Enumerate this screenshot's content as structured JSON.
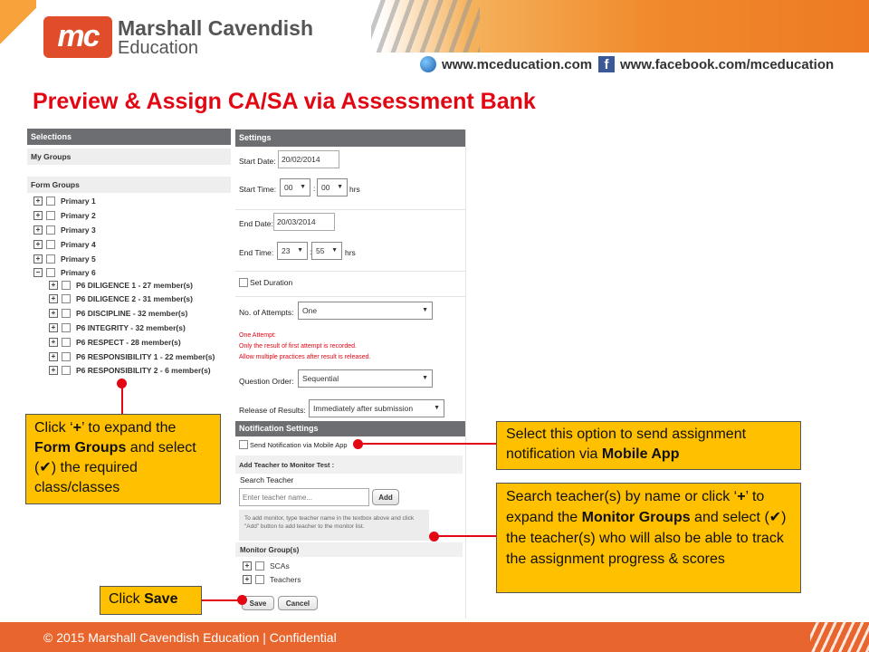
{
  "header": {
    "logo_text": "mc",
    "brand_line1": "Marshall Cavendish",
    "brand_line2": "Education",
    "website": "www.mceducation.com",
    "facebook": "www.facebook.com/mceducation",
    "accent_color": "#e8662d"
  },
  "page_title": "Preview & Assign CA/SA via Assessment Bank",
  "selections": {
    "title": "Selections",
    "my_groups": "My Groups",
    "form_groups": "Form Groups",
    "primary": [
      "Primary 1",
      "Primary 2",
      "Primary 3",
      "Primary 4",
      "Primary 5",
      "Primary 6"
    ],
    "classes": [
      "P6 DILIGENCE 1 - 27 member(s)",
      "P6 DILIGENCE 2 - 31 member(s)",
      "P6 DISCIPLINE - 32 member(s)",
      "P6 INTEGRITY - 32 member(s)",
      "P6 RESPECT - 28 member(s)",
      "P6 RESPONSIBILITY 1 - 22 member(s)",
      "P6 RESPONSIBILITY 2 - 6 member(s)"
    ],
    "expand_symbol": "+",
    "collapse_symbol": "−"
  },
  "settings": {
    "title": "Settings",
    "start_date_label": "Start Date:",
    "start_date": "20/02/2014",
    "start_time_label": "Start Time:",
    "start_hour": "00",
    "start_min": "00",
    "colon": ":",
    "hrs": "hrs",
    "end_date_label": "End Date:",
    "end_date": "20/03/2014",
    "end_time_label": "End Time:",
    "end_hour": "23",
    "end_min": "55",
    "set_duration": "Set Duration",
    "attempts_label": "No. of Attempts:",
    "attempts_value": "One",
    "attempt_note1": "One Attempt:",
    "attempt_note2": "Only the result of first attempt is recorded.",
    "attempt_note3": "Allow multiple practices after result is released.",
    "question_order_label": "Question Order:",
    "question_order_value": "Sequential",
    "release_label": "Release of Results:",
    "release_value": "Immediately after submission"
  },
  "notification": {
    "title": "Notification Settings",
    "send_mobile": "Send Notification via Mobile App",
    "add_teacher_title": "Add Teacher to Monitor Test :",
    "search_teacher": "Search Teacher",
    "search_placeholder": "Enter teacher name...",
    "add_button": "Add",
    "hint": "To add monitor, type teacher name in the textbox above and click \"Add\" button to add teacher to the monitor list.",
    "monitor_groups": "Monitor Group(s)",
    "groups": [
      "SCAs",
      "Teachers"
    ],
    "save": "Save",
    "cancel": "Cancel"
  },
  "callouts": {
    "form_groups_parts": [
      "Click ‘",
      "+",
      "’ to expand the ",
      "Form Groups",
      " and select (✔) the required class/classes"
    ],
    "mobile_parts": [
      "Select this option to send  assignment notification via ",
      "Mobile App"
    ],
    "monitor_parts": [
      "Search teacher(s) by name or click ‘",
      "+",
      "’ to expand the ",
      "Monitor Groups",
      " and select (✔) the teacher(s) who will also be able to track the assignment progress & scores"
    ],
    "save_parts": [
      "Click ",
      "Save"
    ]
  },
  "footer": "© 2015 Marshall Cavendish Education | Confidential"
}
